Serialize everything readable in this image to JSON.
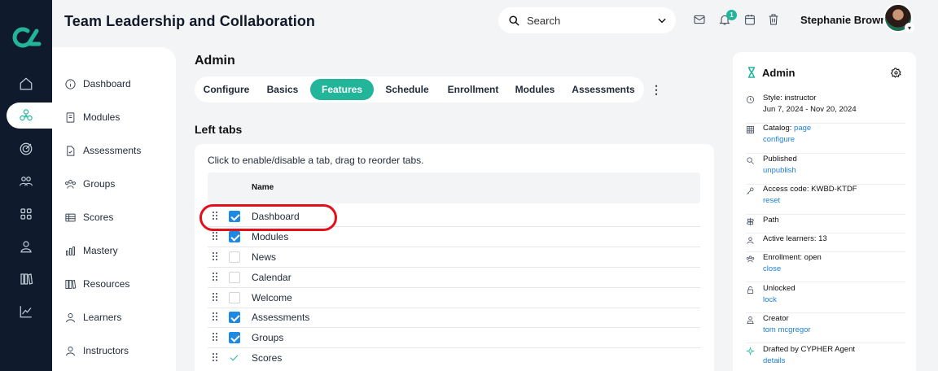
{
  "header": {
    "title": "Team Leadership and Collaboration",
    "search_placeholder": "Search",
    "notification_count": "1",
    "user_name": "Stephanie Brown"
  },
  "rail": {
    "icons": [
      "home-icon",
      "network-icon",
      "target-icon",
      "people-icon",
      "grid-icon",
      "person-icon",
      "library-icon",
      "chart-icon"
    ],
    "active": "network-icon"
  },
  "subnav": {
    "items": [
      {
        "label": "Dashboard",
        "icon": "info-icon"
      },
      {
        "label": "Modules",
        "icon": "book-icon"
      },
      {
        "label": "Assessments",
        "icon": "document-icon"
      },
      {
        "label": "Groups",
        "icon": "group-icon"
      },
      {
        "label": "Scores",
        "icon": "table-icon"
      },
      {
        "label": "Mastery",
        "icon": "bar-chart-icon"
      },
      {
        "label": "Resources",
        "icon": "books-icon"
      },
      {
        "label": "Learners",
        "icon": "person-icon"
      },
      {
        "label": "Instructors",
        "icon": "person-icon"
      }
    ]
  },
  "main": {
    "title": "Admin",
    "tabs": [
      {
        "label": "Configure",
        "active": false
      },
      {
        "label": "Basics",
        "active": false
      },
      {
        "label": "Features",
        "active": true
      },
      {
        "label": "Schedule",
        "active": false
      },
      {
        "label": "Enrollment",
        "active": false
      },
      {
        "label": "Modules",
        "active": false
      },
      {
        "label": "Assessments",
        "active": false
      }
    ],
    "more_label": "⋮",
    "section_title": "Left tabs",
    "description": "Click to enable/disable a tab, drag to reorder tabs.",
    "column_name": "Name",
    "rows": [
      {
        "label": "Dashboard",
        "state": "checked"
      },
      {
        "label": "Modules",
        "state": "checked"
      },
      {
        "label": "News",
        "state": "unchecked"
      },
      {
        "label": "Calendar",
        "state": "unchecked"
      },
      {
        "label": "Welcome",
        "state": "unchecked"
      },
      {
        "label": "Assessments",
        "state": "checked"
      },
      {
        "label": "Groups",
        "state": "checked"
      },
      {
        "label": "Scores",
        "state": "locked-on"
      }
    ]
  },
  "panel": {
    "title": "Admin",
    "items": [
      {
        "icon": "clock-icon",
        "line1": "Style: instructor",
        "line2": "Jun 7, 2024 - Nov 20, 2024"
      },
      {
        "icon": "grid-icon",
        "line1": "Catalog: ",
        "line1_link": "page",
        "line2_link": "configure"
      },
      {
        "icon": "search-icon",
        "line1": "Published",
        "line2_link": "unpublish"
      },
      {
        "icon": "key-icon",
        "line1": "Access code: KWBD-KTDF",
        "line2_link": "reset"
      },
      {
        "icon": "signpost-icon",
        "line1": "Path"
      },
      {
        "icon": "person-icon",
        "line1": "Active learners: 13"
      },
      {
        "icon": "group-icon",
        "line1": "Enrollment: open",
        "line2_link": "close"
      },
      {
        "icon": "unlock-icon",
        "line1": "Unlocked",
        "line2_link": "lock"
      },
      {
        "icon": "creator-icon",
        "line1": "Creator",
        "line2_link": "tom mcgregor"
      },
      {
        "icon": "sparkle-icon",
        "line1": "Drafted by CYPHER Agent",
        "line2_link": "details"
      }
    ]
  },
  "colors": {
    "accent": "#22b59a",
    "rail_bg": "#0f1b2d",
    "checkbox_blue": "#1e88e5",
    "link": "#1e7fd6",
    "highlight_ring": "#e3101a"
  }
}
